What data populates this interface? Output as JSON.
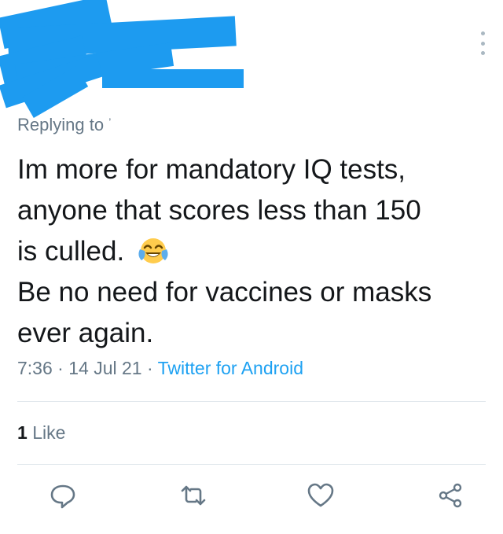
{
  "tweet": {
    "replying_to": "Replying to",
    "reply_handle_mark": "’",
    "text_lines": [
      "Im more for mandatory IQ tests,",
      "anyone that scores less than 150",
      "is culled.",
      "Be no need for vaccines or masks",
      "ever again."
    ],
    "emoji": "face-with-tears-of-joy",
    "time": "7:36",
    "date": "14 Jul 21",
    "source": "Twitter for Android",
    "separator": "·",
    "like_count": "1",
    "like_label": "Like"
  },
  "colors": {
    "redaction": "#1d9bf0",
    "link": "#1da1f2",
    "muted": "#657786",
    "text": "#14171a"
  },
  "actions": [
    "reply-icon",
    "retweet-icon",
    "like-icon",
    "share-icon"
  ]
}
